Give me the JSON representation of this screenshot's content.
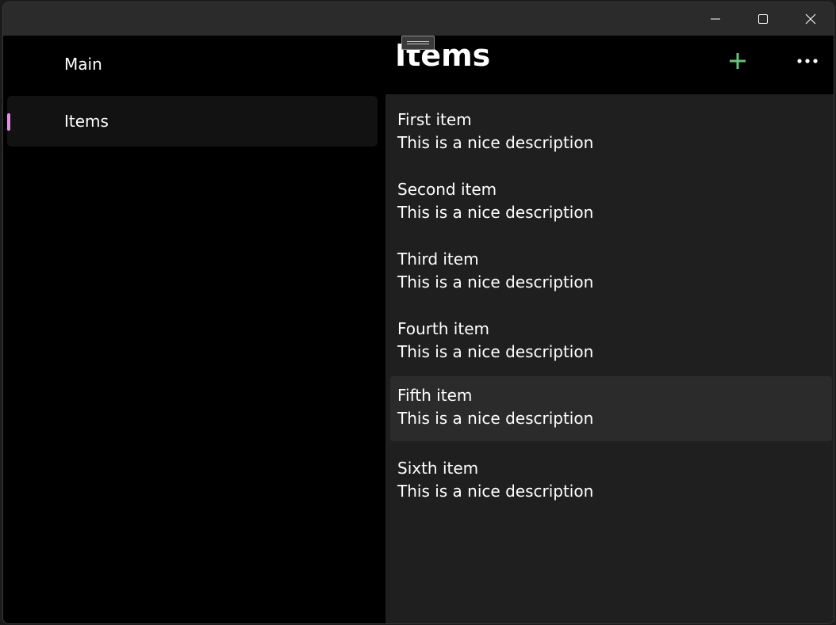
{
  "window": {
    "caption_buttons": [
      "minimize-icon",
      "maximize-icon",
      "close-icon"
    ]
  },
  "nav": {
    "items": [
      {
        "label": "Main",
        "selected": false
      },
      {
        "label": "Items",
        "selected": true
      }
    ],
    "indicator_color": "#e38de6"
  },
  "page": {
    "title": "Items",
    "add_icon": "plus-icon",
    "add_color": "#6cc07a",
    "more_icon": "more-horizontal-icon"
  },
  "list": {
    "items": [
      {
        "title": "First item",
        "description": "This is a nice description"
      },
      {
        "title": "Second item",
        "description": "This is a nice description"
      },
      {
        "title": "Third item",
        "description": "This is a nice description"
      },
      {
        "title": "Fourth item",
        "description": "This is a nice description"
      },
      {
        "title": "Fifth item",
        "description": "This is a nice description"
      },
      {
        "title": "Sixth item",
        "description": "This is a nice description"
      }
    ]
  }
}
